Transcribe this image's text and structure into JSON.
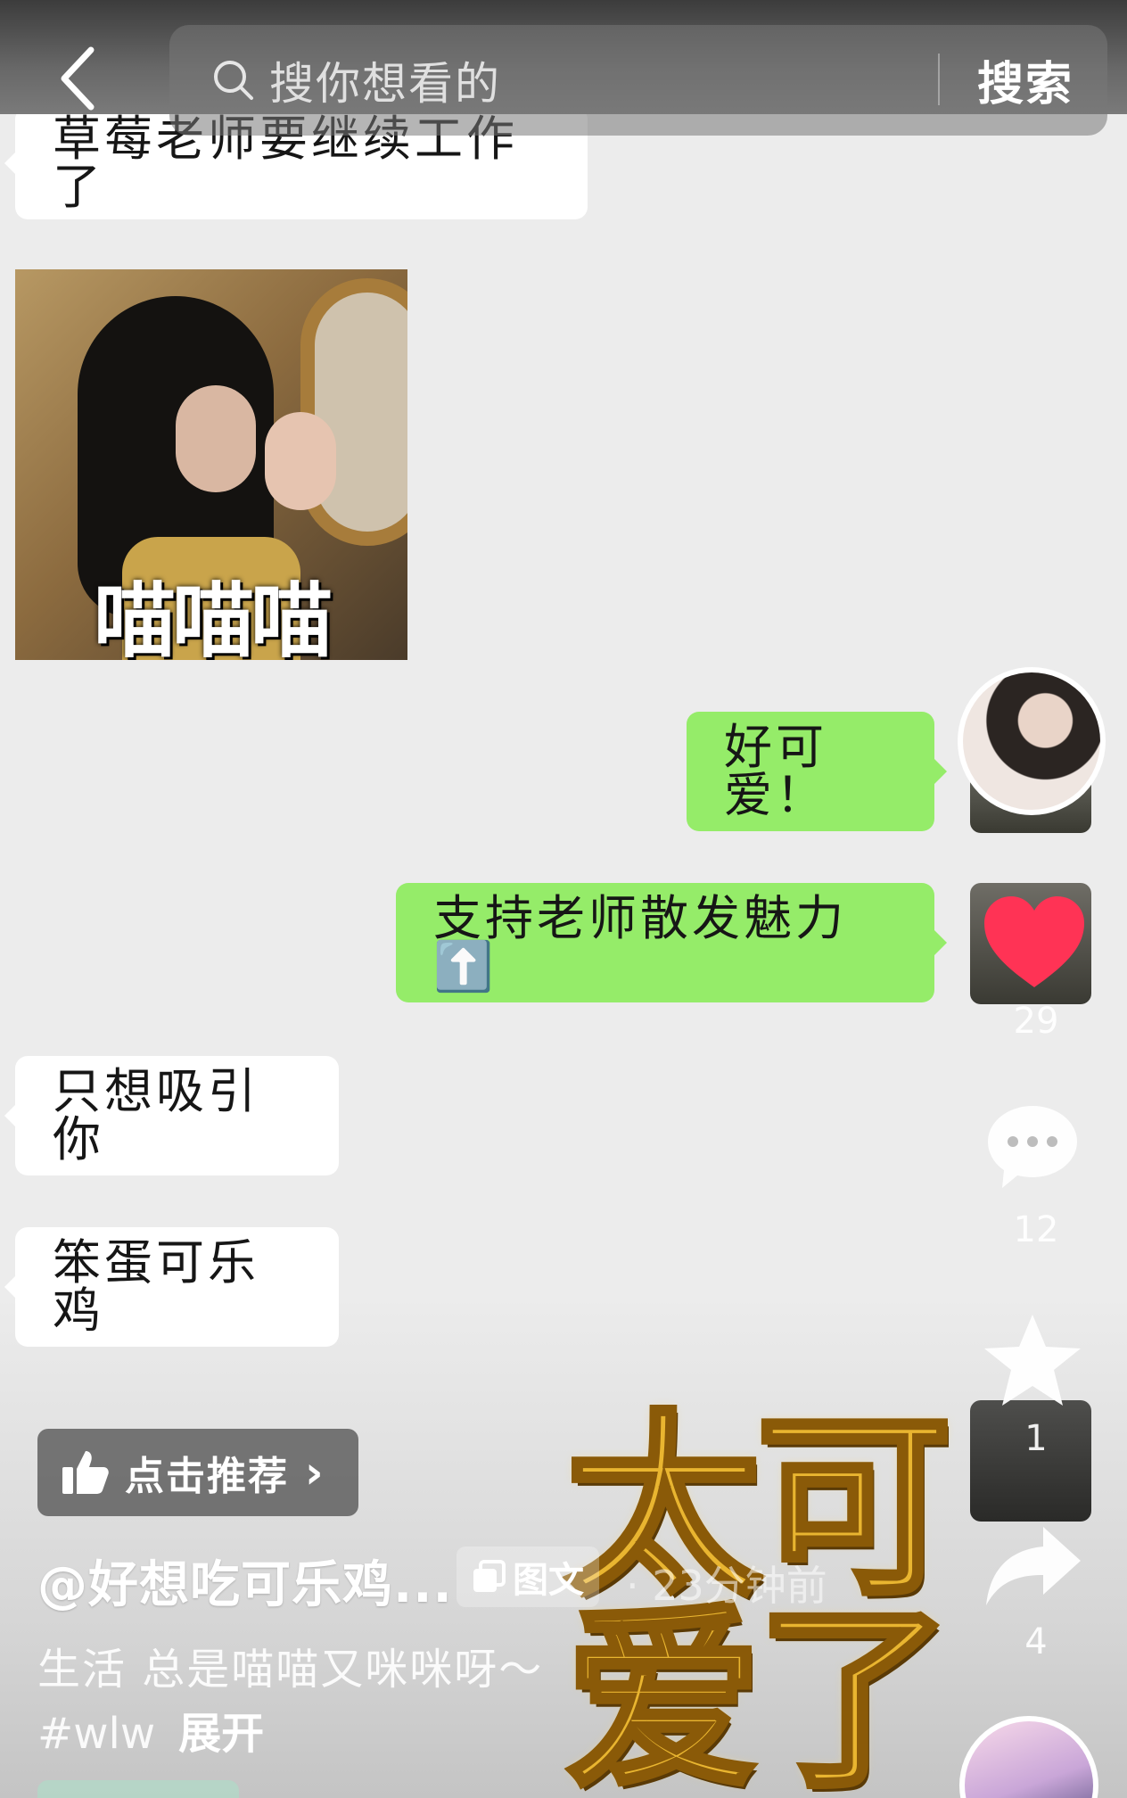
{
  "topbar": {
    "search_placeholder": "搜你想看的",
    "search_button": "搜索"
  },
  "chat": {
    "msg1": "草莓老师要继续工作了",
    "sticker_caption": "喵喵喵",
    "msg2": "好可爱！",
    "msg3": "支持老师散发魅力⬆️",
    "msg4": "只想吸引你",
    "msg5": "笨蛋可乐鸡"
  },
  "actions": {
    "like_count": "29",
    "comment_count": "12",
    "favorite_count": "1",
    "share_count": "4"
  },
  "post": {
    "recommend_label": "点击推荐",
    "author": "@好想吃可乐鸡...",
    "type_badge": "图文",
    "time": "· 23分钟前",
    "description": "生活 总是喵喵又咪咪呀～",
    "tags": "#wlw",
    "expand_label": "展开",
    "overlay_line1": "太可",
    "overlay_line2": "爱了"
  },
  "colors": {
    "outgoing_bubble": "#95ec69",
    "incoming_bubble": "#ffffff",
    "overlay_gold": "#e9b530",
    "heart_red": "#ff3355"
  },
  "icons": [
    "back-arrow-icon",
    "search-icon",
    "heart-icon",
    "comment-icon",
    "star-icon",
    "share-icon",
    "thumbs-up-icon",
    "image-text-icon"
  ]
}
